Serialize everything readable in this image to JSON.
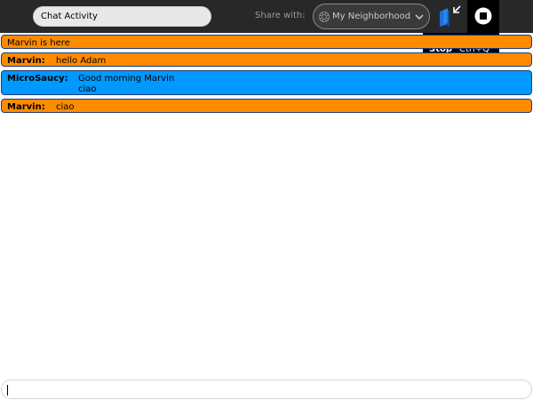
{
  "toolbar": {
    "activity_title": "Chat Activity",
    "share_label": "Share with:",
    "share_value": "My Neighborhood"
  },
  "stop_palette": {
    "label": "Stop",
    "accelerator": "Ctrl+Q"
  },
  "chat": {
    "messages": [
      {
        "text": "Marvin is here"
      },
      {
        "nick": "Marvin:",
        "lines": [
          "hello Adam"
        ]
      },
      {
        "nick": "MicroSaucy:",
        "lines": [
          "Good morning Marvin",
          "ciao"
        ]
      },
      {
        "nick": "Marvin:",
        "lines": [
          "ciao"
        ]
      }
    ]
  },
  "input": {
    "value": ""
  },
  "colors": {
    "toolbar": "#282828",
    "buddy_orange": "#ff8c00",
    "buddy_blue": "#0099ff",
    "bubble_border": "#1e3a78"
  },
  "icons": [
    "neighborhood-icon",
    "chevron-down-icon",
    "keep-journal-icon",
    "stop-icon"
  ]
}
